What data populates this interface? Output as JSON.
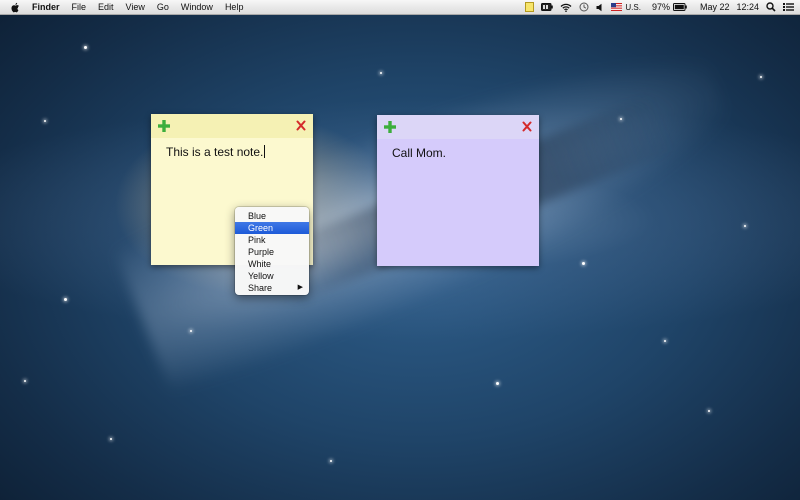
{
  "menubar": {
    "apple_icon": "apple-icon",
    "app_name": "Finder",
    "menus": [
      "File",
      "Edit",
      "View",
      "Go",
      "Window",
      "Help"
    ],
    "status": {
      "input_source": "U.S.",
      "battery_percent": "97%",
      "date": "May 22",
      "time": "12:24",
      "icons": [
        "notes-app-icon",
        "battery-icon",
        "wifi-icon",
        "time-machine-icon",
        "volume-icon",
        "flag-icon",
        "battery-icon",
        "search-icon",
        "list-icon"
      ]
    }
  },
  "notes": [
    {
      "text": "This is a test note.",
      "color": "#fcf9cf",
      "add_icon": "plus-icon",
      "close_icon": "close-icon"
    },
    {
      "text": "Call Mom.",
      "color": "#d5cbfb",
      "add_icon": "plus-icon",
      "close_icon": "close-icon"
    }
  ],
  "color_menu": {
    "items": [
      "Blue",
      "Green",
      "Pink",
      "Purple",
      "White",
      "Yellow",
      "Share"
    ],
    "selected": "Green",
    "submenu_arrow": "▶"
  },
  "colors": {
    "accent": "#1d5ad8",
    "plus": "#3cae3c",
    "close": "#d42a2a"
  }
}
